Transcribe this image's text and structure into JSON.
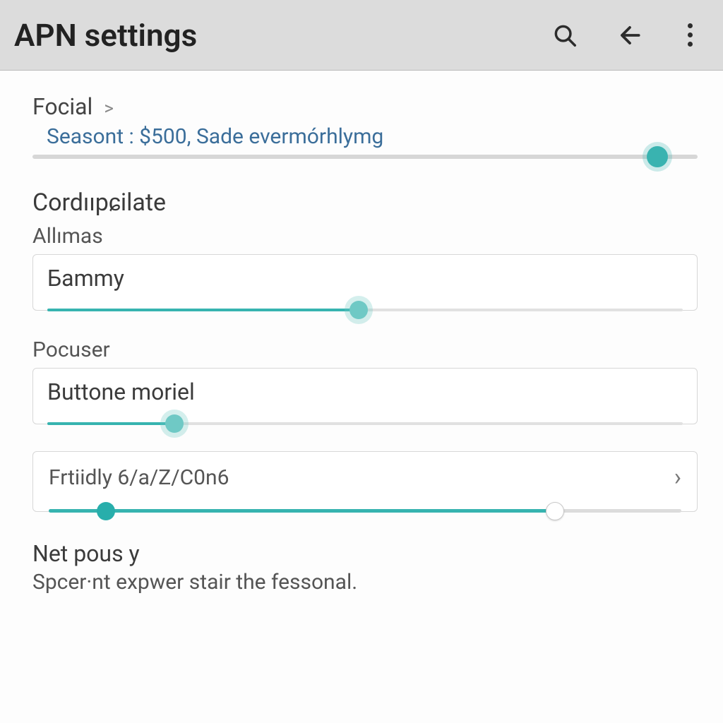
{
  "header": {
    "title": "APN settings"
  },
  "breadcrumb": {
    "label": "Focial",
    "subtext": "Seasont : $500, Sade evermórhlymg",
    "slider_percent": 94
  },
  "section1": {
    "title": "Cordııpɕilate",
    "field_label": "Allımas",
    "value": "Бammy",
    "slider_percent": 49
  },
  "section2": {
    "field_label": "Pocuser",
    "value": "Buttone moriel",
    "slider_percent": 20
  },
  "navrow": {
    "value": "Frtiidly 6/a/Z/C0n6",
    "range_low_percent": 9,
    "range_high_percent": 80
  },
  "bottom": {
    "title": "Net pous y",
    "desc": "Spcer·nt expwer stair the fessonal."
  },
  "colors": {
    "accent": "#37b4b0"
  }
}
